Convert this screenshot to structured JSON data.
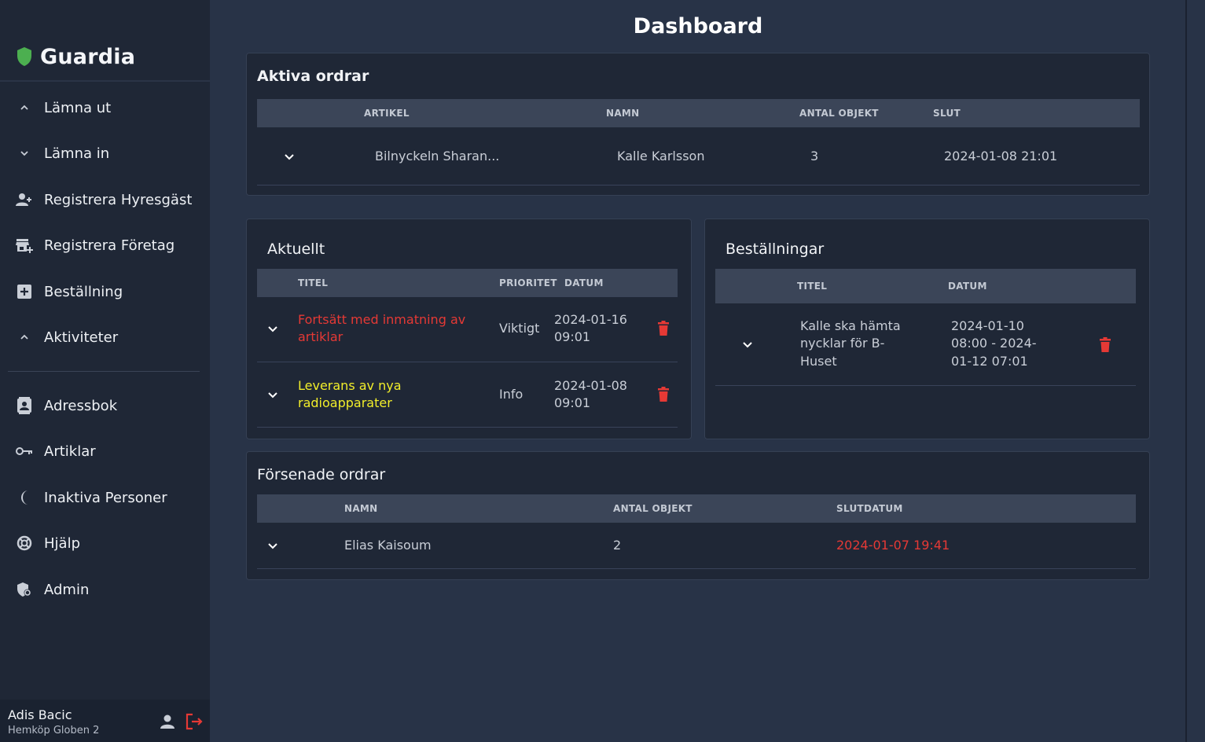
{
  "brand": {
    "name": "Guardia",
    "accent": "#4caf50"
  },
  "sidebar": {
    "items": [
      {
        "label": "Lämna ut",
        "icon": "chevron-up-icon"
      },
      {
        "label": "Lämna in",
        "icon": "chevron-down-icon"
      },
      {
        "label": "Registrera Hyresgäst",
        "icon": "person-add-icon"
      },
      {
        "label": "Registrera Företag",
        "icon": "store-add-icon"
      },
      {
        "label": "Beställning",
        "icon": "plus-box-icon"
      },
      {
        "label": "Aktiviteter",
        "icon": "chevron-up-icon"
      },
      {
        "label": "Adressbok",
        "icon": "contact-card-icon"
      },
      {
        "label": "Artiklar",
        "icon": "key-icon"
      },
      {
        "label": "Inaktiva Personer",
        "icon": "moon-icon"
      },
      {
        "label": "Hjälp",
        "icon": "lifebuoy-icon"
      },
      {
        "label": "Admin",
        "icon": "shield-gear-icon"
      }
    ]
  },
  "user": {
    "name": "Adis Bacic",
    "org": "Hemköp Globen 2"
  },
  "page": {
    "title": "Dashboard"
  },
  "active_orders": {
    "title": "Aktiva ordrar",
    "headers": [
      "ARTIKEL",
      "NAMN",
      "ANTAL OBJEKT",
      "SLUT"
    ],
    "rows": [
      {
        "artikel": "Bilnyckeln Sharan...",
        "namn": "Kalle Karlsson",
        "antal": "3",
        "slut": "2024-01-08 21:01"
      }
    ]
  },
  "current": {
    "title": "Aktuellt",
    "headers": [
      "TITEL",
      "PRIORITET",
      "DATUM"
    ],
    "rows": [
      {
        "title_line1": "Fortsätt med inmatning av",
        "title_line2": "artiklar",
        "priority": "Viktigt",
        "date_line1": "2024-01-16",
        "date_line2": "09:01",
        "color": "#e53935"
      },
      {
        "title_line1": "Leverans av nya",
        "title_line2": "radioapparater",
        "priority": "Info",
        "date_line1": "2024-01-08",
        "date_line2": "09:01",
        "color": "#f2ee2a"
      }
    ]
  },
  "orders": {
    "title": "Beställningar",
    "headers": [
      "TITEL",
      "DATUM"
    ],
    "rows": [
      {
        "title_lines": [
          "Kalle ska hämta",
          "nycklar för B-",
          "Huset"
        ],
        "date_lines": [
          "2024-01-10",
          "08:00 - 2024-",
          "01-12 07:01"
        ]
      }
    ]
  },
  "late_orders": {
    "title": "Försenade ordrar",
    "headers": [
      "NAMN",
      "ANTAL OBJEKT",
      "SLUTDATUM"
    ],
    "rows": [
      {
        "namn": "Elias Kaisoum",
        "antal": "2",
        "slutdatum": "2024-01-07 19:41",
        "slutdatum_color": "#e53935"
      }
    ]
  }
}
